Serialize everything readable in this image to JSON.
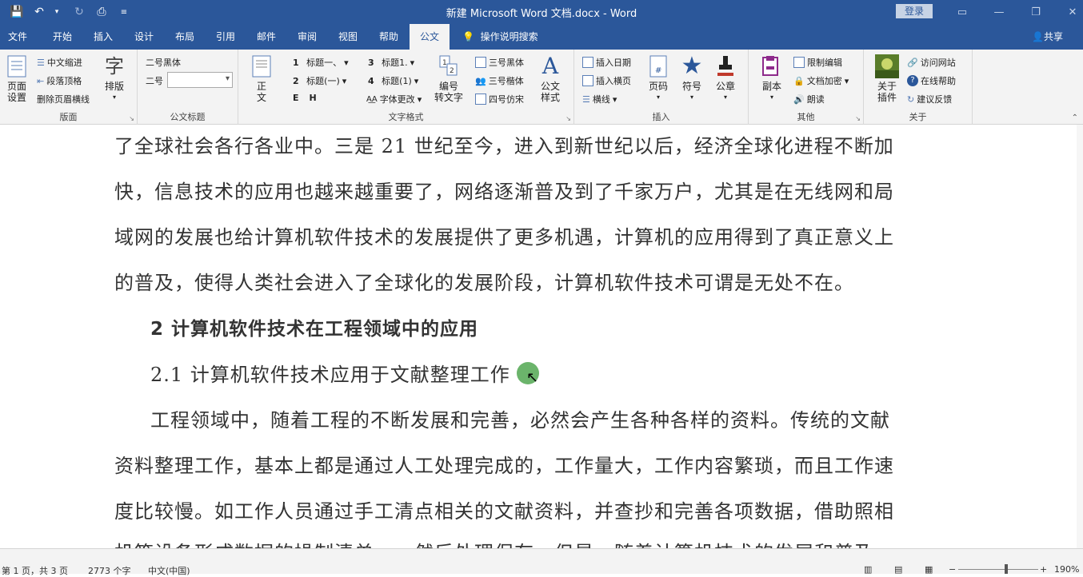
{
  "window": {
    "title": "新建 Microsoft Word 文档.docx  -  Word",
    "login": "登录"
  },
  "tabs": [
    "文件",
    "开始",
    "插入",
    "设计",
    "布局",
    "引用",
    "邮件",
    "审阅",
    "视图",
    "帮助",
    "公文"
  ],
  "active_tab": "公文",
  "tell_me": "操作说明搜索",
  "share": "共享",
  "ribbon": {
    "banmian": {
      "label": "版面",
      "page_setup": "页面\n设置",
      "items": [
        "中文缩进",
        "段落顶格",
        "删除页眉横线"
      ],
      "paiban": "排版"
    },
    "title_group": {
      "label": "公文标题",
      "font": "二号黑体",
      "size_label": "二号"
    },
    "text_format": {
      "label": "文字格式",
      "zhengwen": "正\n文",
      "h1a": "标题一、",
      "h2a": "标题(一)",
      "h3": "标题1.",
      "h4": "标题(1)",
      "font_change": "字体更改",
      "numbering": "编号\n转文字",
      "f1": "三号黑体",
      "f2": "三号楷体",
      "f3": "四号仿宋",
      "style": "公文\n样式"
    },
    "insert": {
      "label": "插入",
      "date": "插入日期",
      "landscape": "插入横页",
      "hline": "横线",
      "pageno": "页码",
      "symbol": "符号",
      "seal": "公章"
    },
    "other": {
      "label": "其他",
      "copy": "副本",
      "restrict": "限制编辑",
      "encrypt": "文档加密",
      "read": "朗读"
    },
    "about": {
      "label": "关于",
      "plugin": "关于\n插件",
      "site": "访问网站",
      "help": "在线帮助",
      "feedback": "建议反馈"
    }
  },
  "document": {
    "lines": [
      "了全球社会各行各业中。三是 21 世纪至今，进入到新世纪以后，经济全球化进程不断加",
      "快，信息技术的应用也越来越重要了，网络逐渐普及到了千家万户，尤其是在无线网和局",
      "域网的发展也给计算机软件技术的发展提供了更多机遇，计算机的应用得到了真正意义上",
      "的普及，使得人类社会进入了全球化的发展阶段，计算机软件技术可谓是无处不在。",
      "2 计算机软件技术在工程领域中的应用",
      "2.1 计算机软件技术应用于文献整理工作",
      "工程领域中，随着工程的不断发展和完善，必然会产生各种各样的资料。传统的文献",
      "资料整理工作，基本上都是通过人工处理完成的，工作量大，工作内容繁琐，而且工作速",
      "度比较慢。如工作人员通过手工清点相关的文献资料，并查抄和完善各项数据，借助照相",
      "机等设备形成数据的操制清单……然后处理保存。但是，随着计算机技术的发展和普及"
    ]
  },
  "status": {
    "page": "第 1 页，共 3 页",
    "words": "2773 个字",
    "lang": "中文(中国)",
    "zoom": "190%"
  }
}
